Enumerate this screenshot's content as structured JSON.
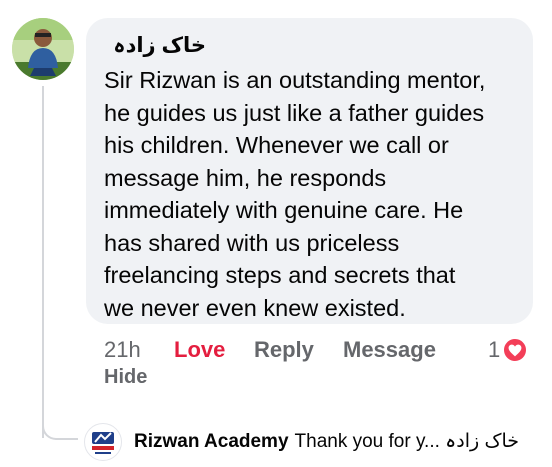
{
  "comment": {
    "author": "خاک زادہ",
    "lines": [
      "Sir Rizwan is an outstanding mentor,",
      "he guides us just like a father guides",
      "his children. Whenever we call or",
      "message him, he responds",
      "immediately with genuine care. He",
      "has shared with us priceless",
      "freelancing steps and secrets that",
      "we never even knew existed."
    ],
    "avatar_icon": "profile-photo"
  },
  "actions": {
    "time": "21h",
    "love": "Love",
    "reply": "Reply",
    "message": "Message",
    "hide": "Hide",
    "reaction_count": "1",
    "reaction_icon": "heart-icon",
    "love_color": "#e41e3f"
  },
  "reply_preview": {
    "name": "Rizwan Academy",
    "text": "Thank you for y... خاک زادہ",
    "avatar_icon": "rizwan-academy-logo"
  }
}
